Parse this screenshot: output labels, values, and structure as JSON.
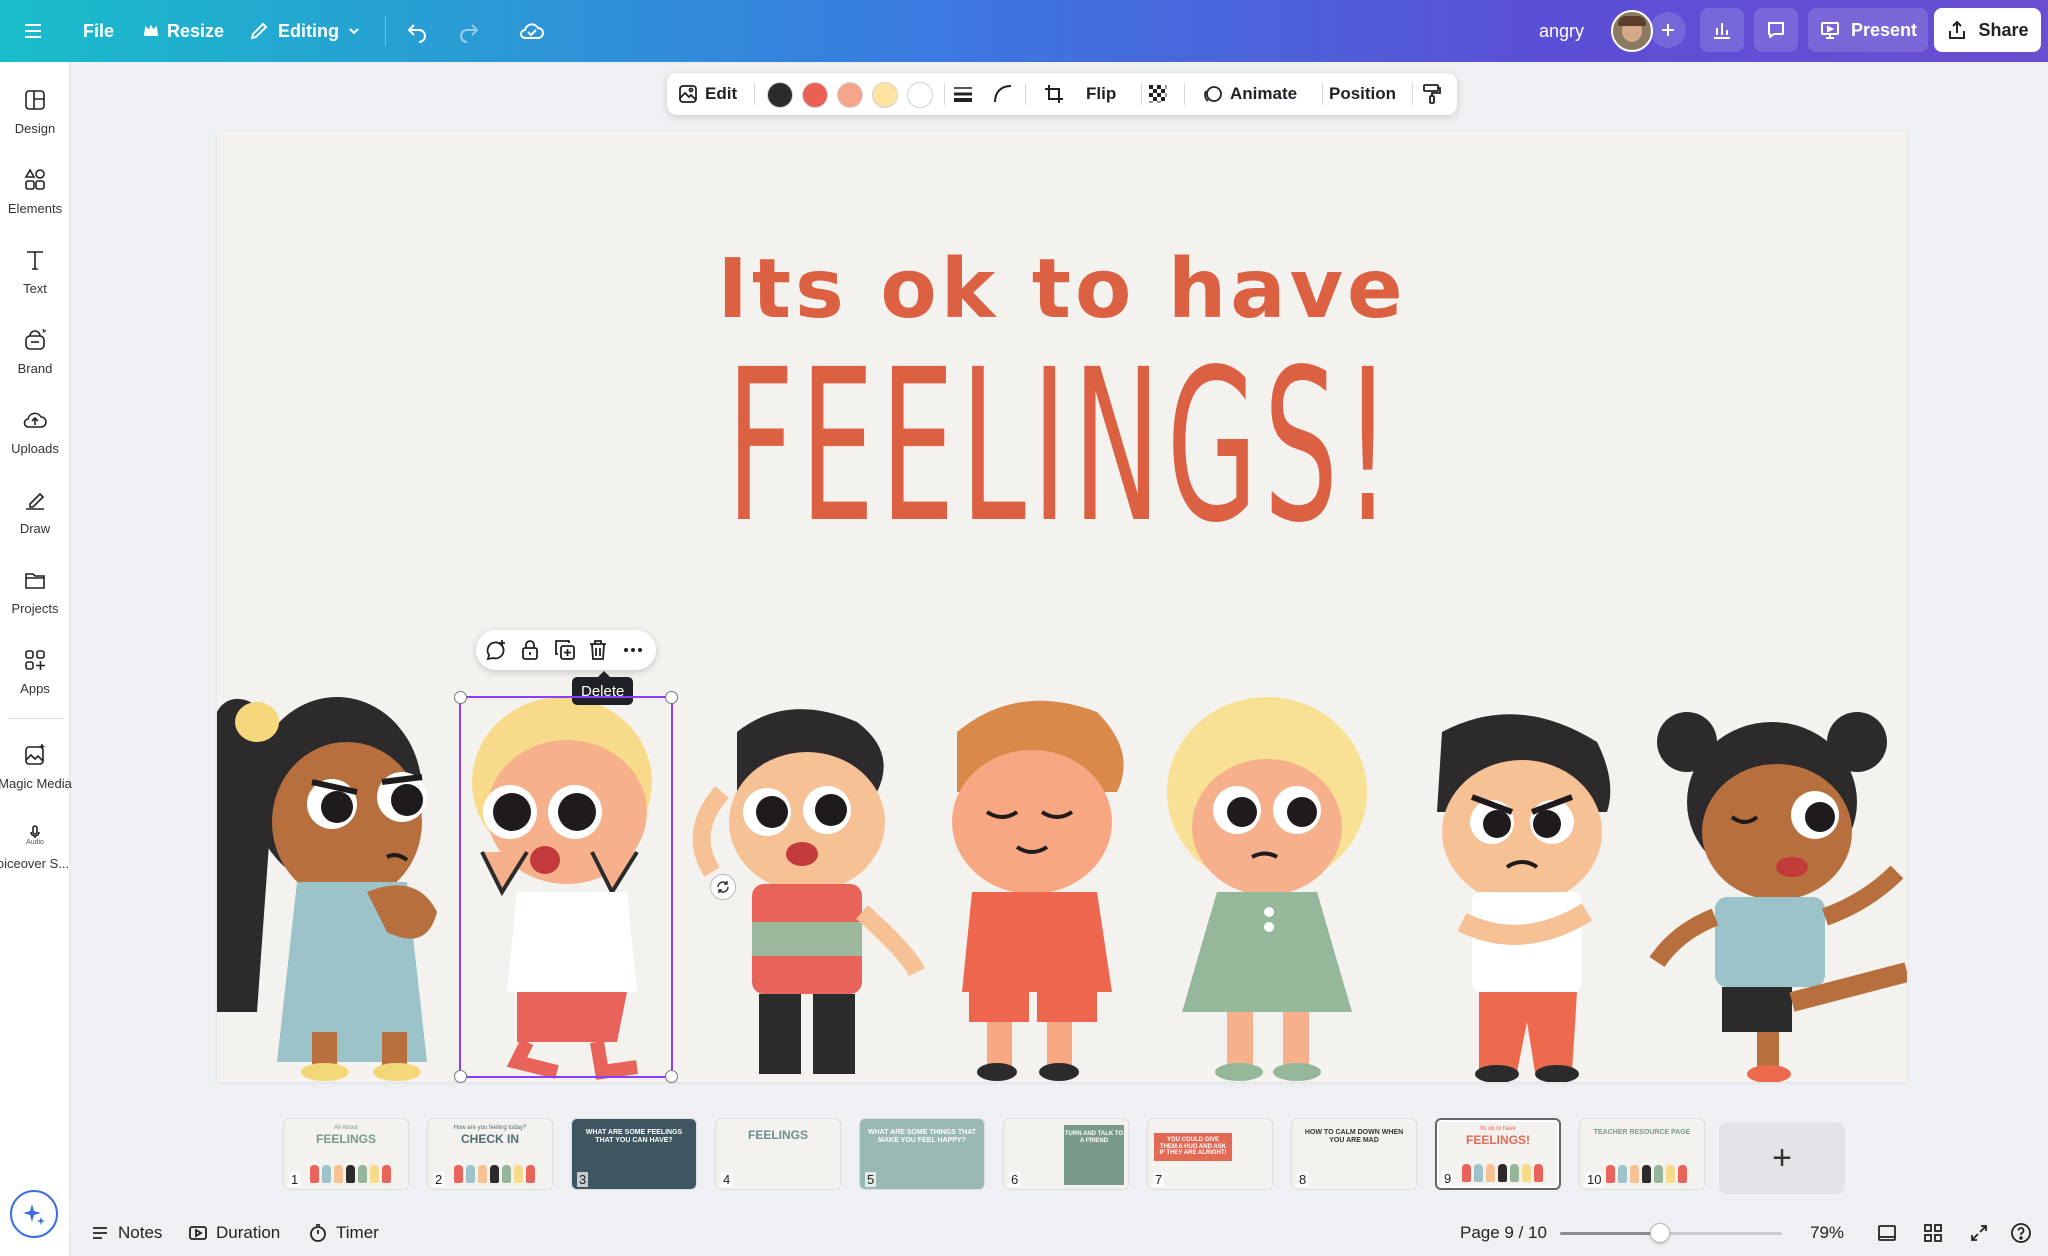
{
  "topbar": {
    "file": "File",
    "resize": "Resize",
    "editing": "Editing",
    "doc_title": "angry",
    "present": "Present",
    "share": "Share"
  },
  "sidebar": {
    "items": [
      {
        "label": "Design",
        "icon": "layout-icon"
      },
      {
        "label": "Elements",
        "icon": "shapes-icon"
      },
      {
        "label": "Text",
        "icon": "text-icon"
      },
      {
        "label": "Brand",
        "icon": "brand-icon"
      },
      {
        "label": "Uploads",
        "icon": "upload-cloud-icon"
      },
      {
        "label": "Draw",
        "icon": "pen-icon"
      },
      {
        "label": "Projects",
        "icon": "folder-icon"
      },
      {
        "label": "Apps",
        "icon": "apps-icon"
      },
      {
        "label": "Magic Media",
        "icon": "magic-media-icon"
      },
      {
        "label": "Voiceover S...",
        "icon": "audio-icon"
      }
    ],
    "audio_badge": "Audio"
  },
  "context_toolbar": {
    "edit": "Edit",
    "colors": [
      "#2b2b2b",
      "#ec5f55",
      "#f7a58a",
      "#ffe3a0",
      "#ffffff"
    ],
    "flip": "Flip",
    "animate": "Animate",
    "position": "Position"
  },
  "slide": {
    "line1": "Its ok to have",
    "line2": "FEELINGS!",
    "text_color": "#dc6042"
  },
  "selection": {
    "tooltip": "Delete"
  },
  "thumbnails": [
    {
      "num": "1",
      "caption": "FEELINGS",
      "sub": "All About"
    },
    {
      "num": "2",
      "caption": "CHECK IN",
      "sub": "How are you feeling today?"
    },
    {
      "num": "3",
      "caption": "WHAT ARE SOME FEELINGS THAT YOU CAN HAVE?",
      "sub": ""
    },
    {
      "num": "4",
      "caption": "FEELINGS",
      "sub": ""
    },
    {
      "num": "5",
      "caption": "WHAT ARE SOME THINGS THAT MAKE YOU FEEL HAPPY?",
      "sub": ""
    },
    {
      "num": "6",
      "caption": "TURN AND TALK TO A FRIEND",
      "sub": ""
    },
    {
      "num": "7",
      "caption": "YOU COULD GIVE THEM A HUG AND ASK IF THEY ARE ALRIGHT!",
      "sub": ""
    },
    {
      "num": "8",
      "caption": "HOW TO CALM DOWN WHEN YOU ARE MAD",
      "sub": ""
    },
    {
      "num": "9",
      "caption": "FEELINGS!",
      "sub": "Its ok to have"
    },
    {
      "num": "10",
      "caption": "TEACHER RESOURCE PAGE",
      "sub": ""
    }
  ],
  "bottom": {
    "notes": "Notes",
    "duration": "Duration",
    "timer": "Timer",
    "page": "Page 9 / 10",
    "zoom": "79%",
    "zoom_level": 0.79
  }
}
